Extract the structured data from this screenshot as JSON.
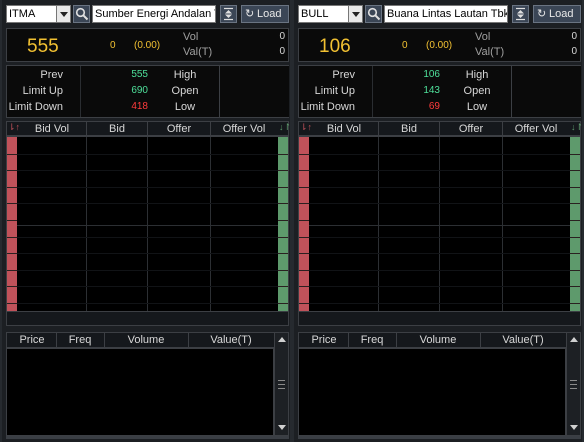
{
  "load_label": "Load",
  "labels": {
    "vol": "Vol",
    "val": "Val(T)",
    "prev": "Prev",
    "limit_up": "Limit Up",
    "limit_down": "Limit Down",
    "high": "High",
    "open": "Open",
    "low": "Low"
  },
  "book_headers": [
    "Bid Vol",
    "Bid",
    "Offer",
    "Offer Vol"
  ],
  "trade_headers": [
    "Price",
    "Freq",
    "Volume",
    "Value(T)"
  ],
  "colors": {
    "price": "#f2c132",
    "up": "#4ee09a",
    "down": "#ff3c3c",
    "bid_bar": "#c0525a",
    "offer_bar": "#5e9a6c"
  },
  "panels": [
    {
      "code": "ITMA",
      "name": "Sumber Energi Andalan Tbk",
      "last": "555",
      "change": "0",
      "change_pct": "(0.00)",
      "vol": "0",
      "val": "0",
      "prev": "555",
      "limit_up": "690",
      "limit_down": "418"
    },
    {
      "code": "BULL",
      "name": "Buana Lintas Lautan Tbk",
      "last": "106",
      "change": "0",
      "change_pct": "(0.00)",
      "vol": "0",
      "val": "0",
      "prev": "106",
      "limit_up": "143",
      "limit_down": "69"
    }
  ]
}
